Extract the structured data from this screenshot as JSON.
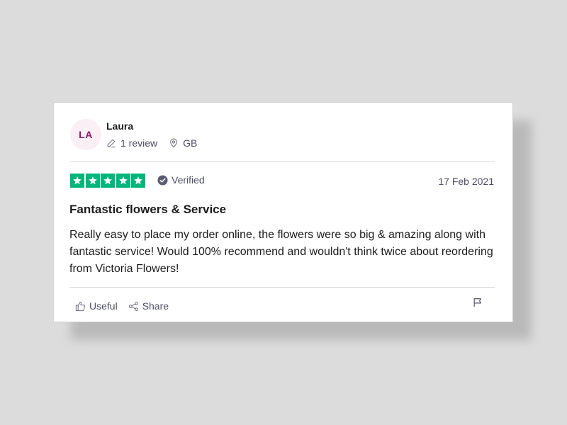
{
  "reviewer": {
    "initials": "LA",
    "name": "Laura",
    "review_count": "1 review",
    "country": "GB"
  },
  "rating": {
    "stars": 5,
    "max": 5,
    "color": "#00b67a"
  },
  "verified_label": "Verified",
  "date": "17 Feb 2021",
  "review": {
    "title": "Fantastic flowers & Service",
    "body": "Really easy to place my order online, the flowers were so big & amazing along with fantastic service! Would 100% recommend and wouldn't think twice about reordering from Victoria Flowers!"
  },
  "actions": {
    "useful_label": "Useful",
    "share_label": "Share"
  },
  "icons": {
    "review_count": "pencil-icon",
    "country": "location-pin-icon",
    "verified": "check-circle-icon",
    "useful": "thumbs-up-icon",
    "share": "share-icon",
    "report": "flag-icon"
  },
  "colors": {
    "avatar_bg": "#fbeff6",
    "avatar_text": "#8c1b6b",
    "muted_text": "#4e4e66"
  }
}
